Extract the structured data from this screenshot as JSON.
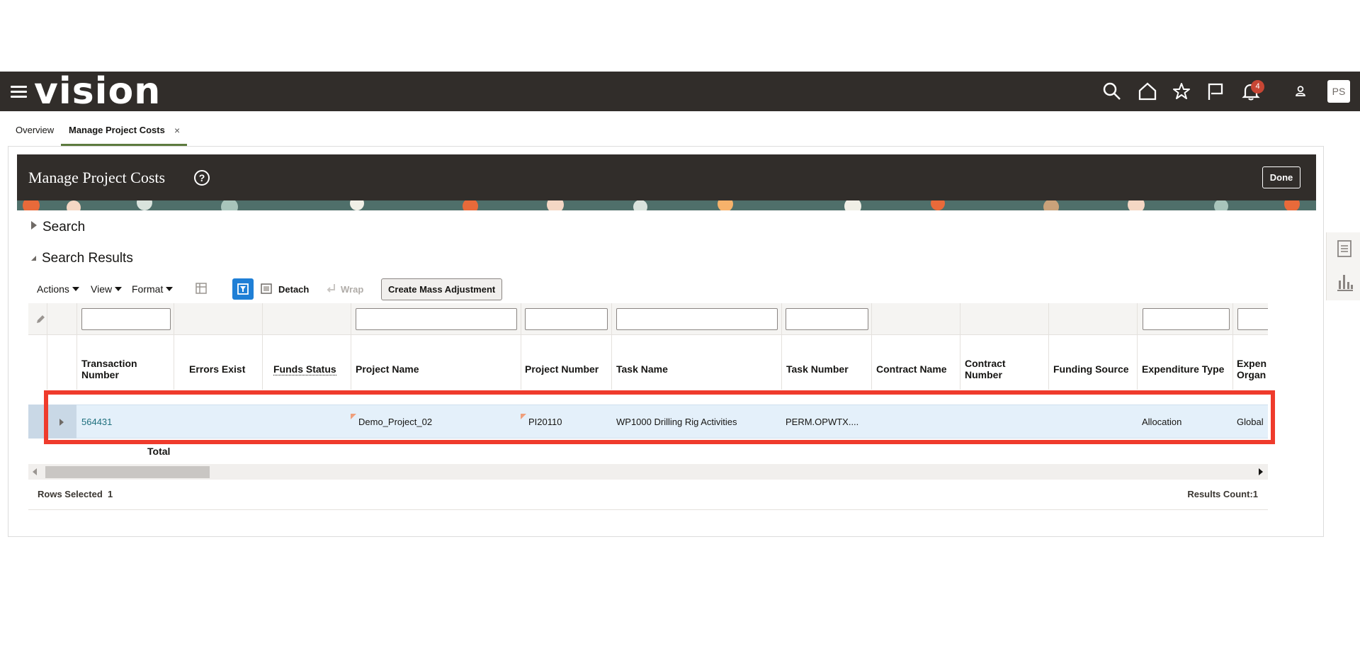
{
  "app": {
    "logo_text": "vision",
    "notification_count": "4",
    "user_initials": "PS"
  },
  "tabs": [
    {
      "label": "Overview"
    },
    {
      "label": "Manage Project Costs",
      "close": "×"
    }
  ],
  "page": {
    "title": "Manage Project Costs",
    "help": "?",
    "done_label": "Done"
  },
  "sections": {
    "search": "Search",
    "search_results": "Search Results"
  },
  "toolbar": {
    "actions": "Actions",
    "view": "View",
    "format": "Format",
    "detach": "Detach",
    "wrap": "Wrap",
    "create_mass_adjustment": "Create Mass Adjustment"
  },
  "table": {
    "columns": [
      {
        "line1": "Transaction",
        "line2": "Number"
      },
      {
        "line1": "Errors Exist",
        "line2": ""
      },
      {
        "line1": "Funds Status",
        "line2": ""
      },
      {
        "line1": "Project Name",
        "line2": ""
      },
      {
        "line1": "Project Number",
        "line2": ""
      },
      {
        "line1": "Task Name",
        "line2": ""
      },
      {
        "line1": "Task Number",
        "line2": ""
      },
      {
        "line1": "Contract Name",
        "line2": ""
      },
      {
        "line1": "Contract",
        "line2": "Number"
      },
      {
        "line1": "Funding Source",
        "line2": ""
      },
      {
        "line1": "Expenditure Type",
        "line2": ""
      },
      {
        "line1": "Expen",
        "line2": "Organ"
      }
    ],
    "row": {
      "transaction_number": "564431",
      "errors_exist": "",
      "funds_status": "",
      "project_name": "Demo_Project_02",
      "project_number": "PI20110",
      "task_name": "WP1000 Drilling Rig Activities",
      "task_number": "PERM.OPWTX....",
      "contract_name": "",
      "contract_number": "",
      "funding_source": "",
      "expenditure_type": "Allocation",
      "expenditure_org": "Global"
    },
    "total_label": "Total"
  },
  "status": {
    "rows_selected_label": "Rows Selected",
    "rows_selected_value": "1",
    "results_count": "Results Count:1"
  },
  "colors": {
    "header_bg": "#312d2a",
    "highlight": "#ef3b2c",
    "row_selected": "#e4f0fa",
    "link": "#1e6f7d",
    "badge": "#c74634"
  }
}
